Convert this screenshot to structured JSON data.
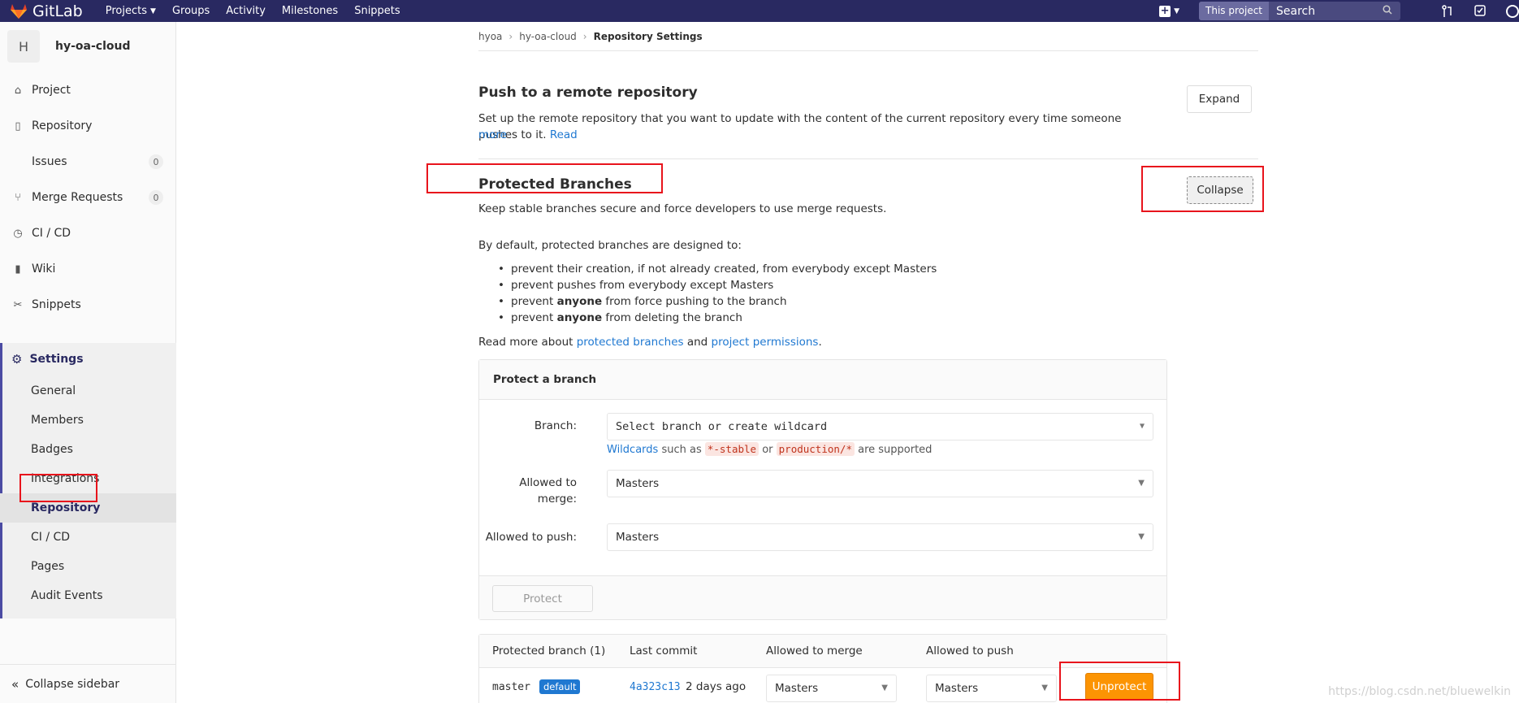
{
  "navbar": {
    "brand": "GitLab",
    "links": [
      {
        "label": "Projects",
        "has_caret": true
      },
      {
        "label": "Groups"
      },
      {
        "label": "Activity"
      },
      {
        "label": "Milestones"
      },
      {
        "label": "Snippets"
      }
    ],
    "search_scope": "This project",
    "search_placeholder": "Search"
  },
  "sidebar": {
    "project_avatar": "H",
    "project_name": "hy-oa-cloud",
    "items": [
      {
        "label": "Project",
        "icon": "home-icon"
      },
      {
        "label": "Repository",
        "icon": "book-icon"
      },
      {
        "label": "Issues",
        "count": "0"
      },
      {
        "label": "Merge Requests",
        "count": "0",
        "icon": "merge-request-icon"
      },
      {
        "label": "CI / CD",
        "icon": "rocket-icon"
      },
      {
        "label": "Wiki",
        "icon": "wiki-icon"
      },
      {
        "label": "Snippets",
        "icon": "scissors-icon"
      }
    ],
    "settings": {
      "label": "Settings",
      "sub": [
        "General",
        "Members",
        "Badges",
        "Integrations",
        "Repository",
        "CI / CD",
        "Pages",
        "Audit Events"
      ],
      "active": "Repository"
    },
    "collapse_label": "Collapse sidebar"
  },
  "breadcrumb": [
    "hyoa",
    "hy-oa-cloud",
    "Repository Settings"
  ],
  "push_section": {
    "title": "Push to a remote repository",
    "desc_a": "Set up the remote repository that you want to update with the content of the current repository every time someone pushes to it.",
    "desc_link_1": "Read",
    "desc_link_2": "more",
    "button": "Expand"
  },
  "protected": {
    "title": "Protected Branches",
    "subtitle": "Keep stable branches secure and force developers to use merge requests.",
    "button": "Collapse",
    "intro": "By default, protected branches are designed to:",
    "bullets": [
      {
        "pre": "prevent their creation, if not already created, from everybody except Masters",
        "bold": "",
        "post": ""
      },
      {
        "pre": "prevent pushes from everybody except Masters",
        "bold": "",
        "post": ""
      },
      {
        "pre": "prevent ",
        "bold": "anyone",
        "post": " from force pushing to the branch"
      },
      {
        "pre": "prevent ",
        "bold": "anyone",
        "post": " from deleting the branch"
      }
    ],
    "read_more_pre": "Read more about ",
    "read_more_link1": "protected branches",
    "read_more_mid": " and ",
    "read_more_link2": "project permissions",
    "read_more_post": ".",
    "form": {
      "title": "Protect a branch",
      "branch_label": "Branch:",
      "branch_placeholder": "Select branch or create wildcard",
      "help_link": "Wildcards",
      "help_mid1": " such as ",
      "help_code1": "*-stable",
      "help_mid2": " or ",
      "help_code2": "production/*",
      "help_post": " are supported",
      "merge_label_1": "Allowed to",
      "merge_label_2": "merge:",
      "merge_value": "Masters",
      "push_label": "Allowed to push:",
      "push_value": "Masters",
      "submit": "Protect"
    },
    "table": {
      "headers": [
        "Protected branch (1)",
        "Last commit",
        "Allowed to merge",
        "Allowed to push"
      ],
      "row": {
        "branch": "master",
        "badge": "default",
        "commit": "4a323c13",
        "ago": "2 days ago",
        "merge": "Masters",
        "push": "Masters",
        "action": "Unprotect"
      }
    }
  },
  "watermark": "https://blog.csdn.net/bluewelkin"
}
